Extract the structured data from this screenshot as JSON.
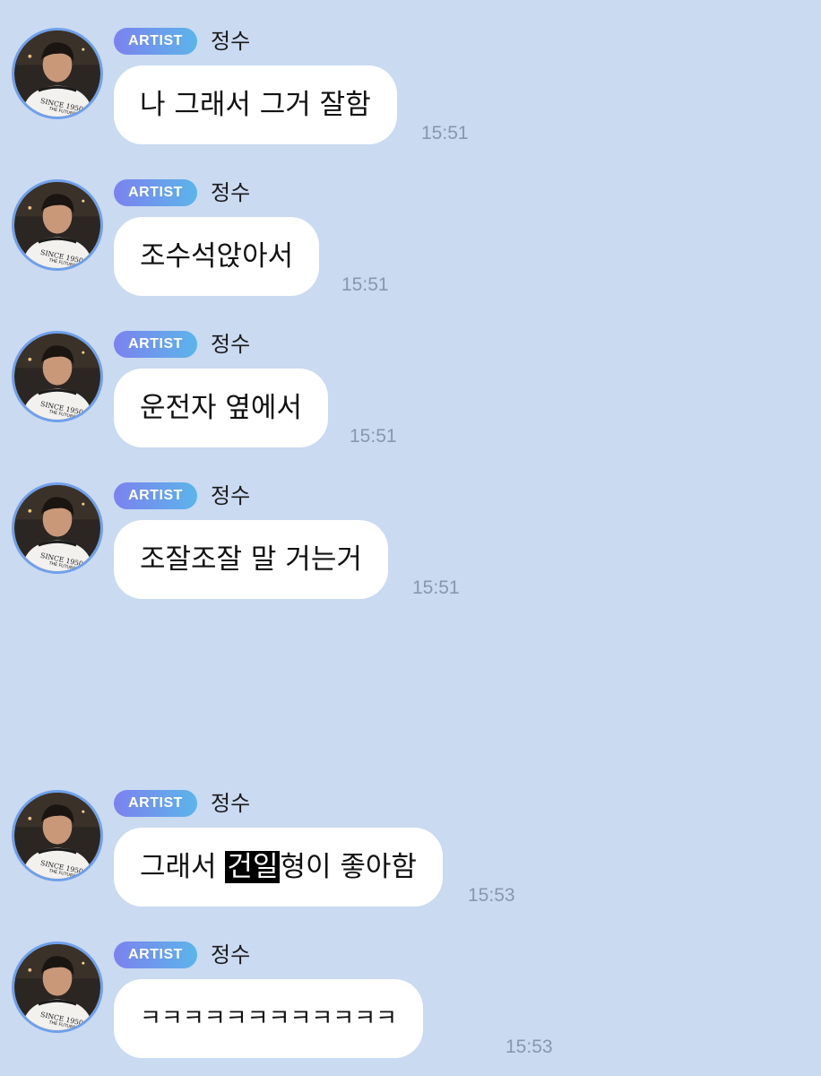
{
  "theme": {
    "background": "#c9daf1",
    "bubble": "#ffffff",
    "badge_gradient": [
      "#7b82ee",
      "#5cb4ea"
    ],
    "avatar_ring": "#6fa0ea",
    "time_color": "#8a97ab"
  },
  "messages": [
    {
      "badge": "ARTIST",
      "sender": "정수",
      "avatar_icon": "profile-photo",
      "avatar_text": [
        "SINCE 1950",
        "THE FUTURE"
      ],
      "text": "나 그래서 그거 잘함",
      "time": "15:51"
    },
    {
      "badge": "ARTIST",
      "sender": "정수",
      "avatar_icon": "profile-photo",
      "avatar_text": [
        "SINCE 1950",
        "THE FUTURE"
      ],
      "text": "조수석앉아서",
      "time": "15:51"
    },
    {
      "badge": "ARTIST",
      "sender": "정수",
      "avatar_icon": "profile-photo",
      "avatar_text": [
        "SINCE 1950",
        "THE FUTURE"
      ],
      "text": "운전자 옆에서",
      "time": "15:51"
    },
    {
      "badge": "ARTIST",
      "sender": "정수",
      "avatar_icon": "profile-photo",
      "avatar_text": [
        "SINCE 1950",
        "THE FUTURE"
      ],
      "text": "조잘조잘 말 거는거",
      "time": "15:51"
    },
    {
      "badge": "ARTIST",
      "sender": "정수",
      "avatar_icon": "profile-photo",
      "avatar_text": [
        "SINCE 1950",
        "THE FUTURE"
      ],
      "text_before": "그래서 ",
      "text_highlight": "건일",
      "text_after": "형이 좋아함",
      "time": "15:53"
    },
    {
      "badge": "ARTIST",
      "sender": "정수",
      "avatar_icon": "profile-photo",
      "avatar_text": [
        "SINCE 1950",
        "THE FUTURE"
      ],
      "text": "ㅋㅋㅋㅋㅋㅋㅋㅋㅋㅋㅋㅋ",
      "time": "15:53"
    }
  ]
}
